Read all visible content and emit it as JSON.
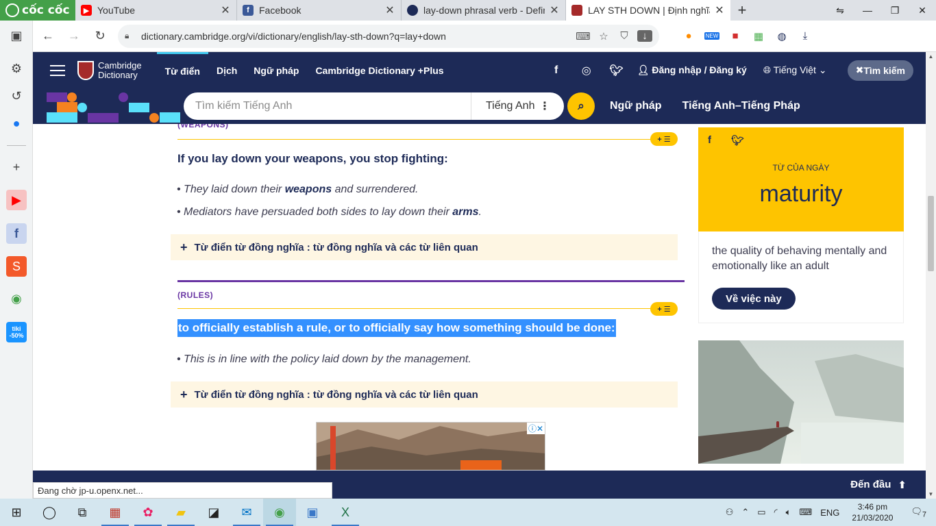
{
  "browser": {
    "brand": "cốc cốc",
    "tabs": [
      {
        "label": "YouTube",
        "favicon": "youtube-icon",
        "color": "#ff0000"
      },
      {
        "label": "Facebook",
        "favicon": "facebook-icon",
        "color": "#3b5998"
      },
      {
        "label": "lay-down phrasal verb - Defin",
        "favicon": "oxford-icon",
        "color": "#1d2a57"
      },
      {
        "label": "LAY STH DOWN | Định nghĩa",
        "favicon": "cambridge-icon",
        "color": "#a52a2a",
        "active": true
      }
    ],
    "url": "dictionary.cambridge.org/vi/dictionary/english/lay-sth-down?q=lay+down",
    "ext_badge": "NEW"
  },
  "site": {
    "logo_line1": "Cambridge",
    "logo_line2": "Dictionary",
    "nav": [
      "Từ điển",
      "Dịch",
      "Ngữ pháp",
      "Cambridge Dictionary +Plus"
    ],
    "login": "Đăng nhập / Đăng ký",
    "language": "Tiếng Việt",
    "search_toggle": "Tìm kiếm",
    "search_placeholder": "Tìm kiếm Tiếng Anh",
    "search_lang": "Tiếng Anh",
    "sub_links": [
      "Ngữ pháp",
      "Tiếng Anh–Tiếng Pháp"
    ]
  },
  "entry": {
    "sense1": {
      "guideword": "(WEAPONS)",
      "add_label": "+ ☰",
      "definition": "If you lay down your weapons, you stop fighting:",
      "ex1_pre": "They laid down their ",
      "ex1_bold": "weapons",
      "ex1_post": " and surrendered.",
      "ex2_pre": "Mediators have persuaded both sides to lay down their ",
      "ex2_bold": "arms",
      "ex2_post": ".",
      "thesaurus": "Từ điển từ đồng nghĩa : từ đồng nghĩa và các từ liên quan"
    },
    "sense2": {
      "guideword": "(RULES)",
      "add_label": "+ ☰",
      "definition": "to officially establish a rule, or to officially say how something should be done:",
      "ex1": "This is in line with the policy laid down by the management.",
      "thesaurus": "Từ điển từ đồng nghĩa : từ đồng nghĩa và các từ liên quan"
    }
  },
  "wotd": {
    "label": "TỪ CỦA NGÀY",
    "word": "maturity",
    "definition": "the quality of behaving mentally and emotionally like an adult",
    "button": "Về việc này"
  },
  "bottom": {
    "to_top": "Đến đầu",
    "status": "Đang chờ jp-u.openx.net..."
  },
  "taskbar": {
    "lang": "ENG",
    "time": "3:46 pm",
    "date": "21/03/2020",
    "notif_count": "7"
  }
}
